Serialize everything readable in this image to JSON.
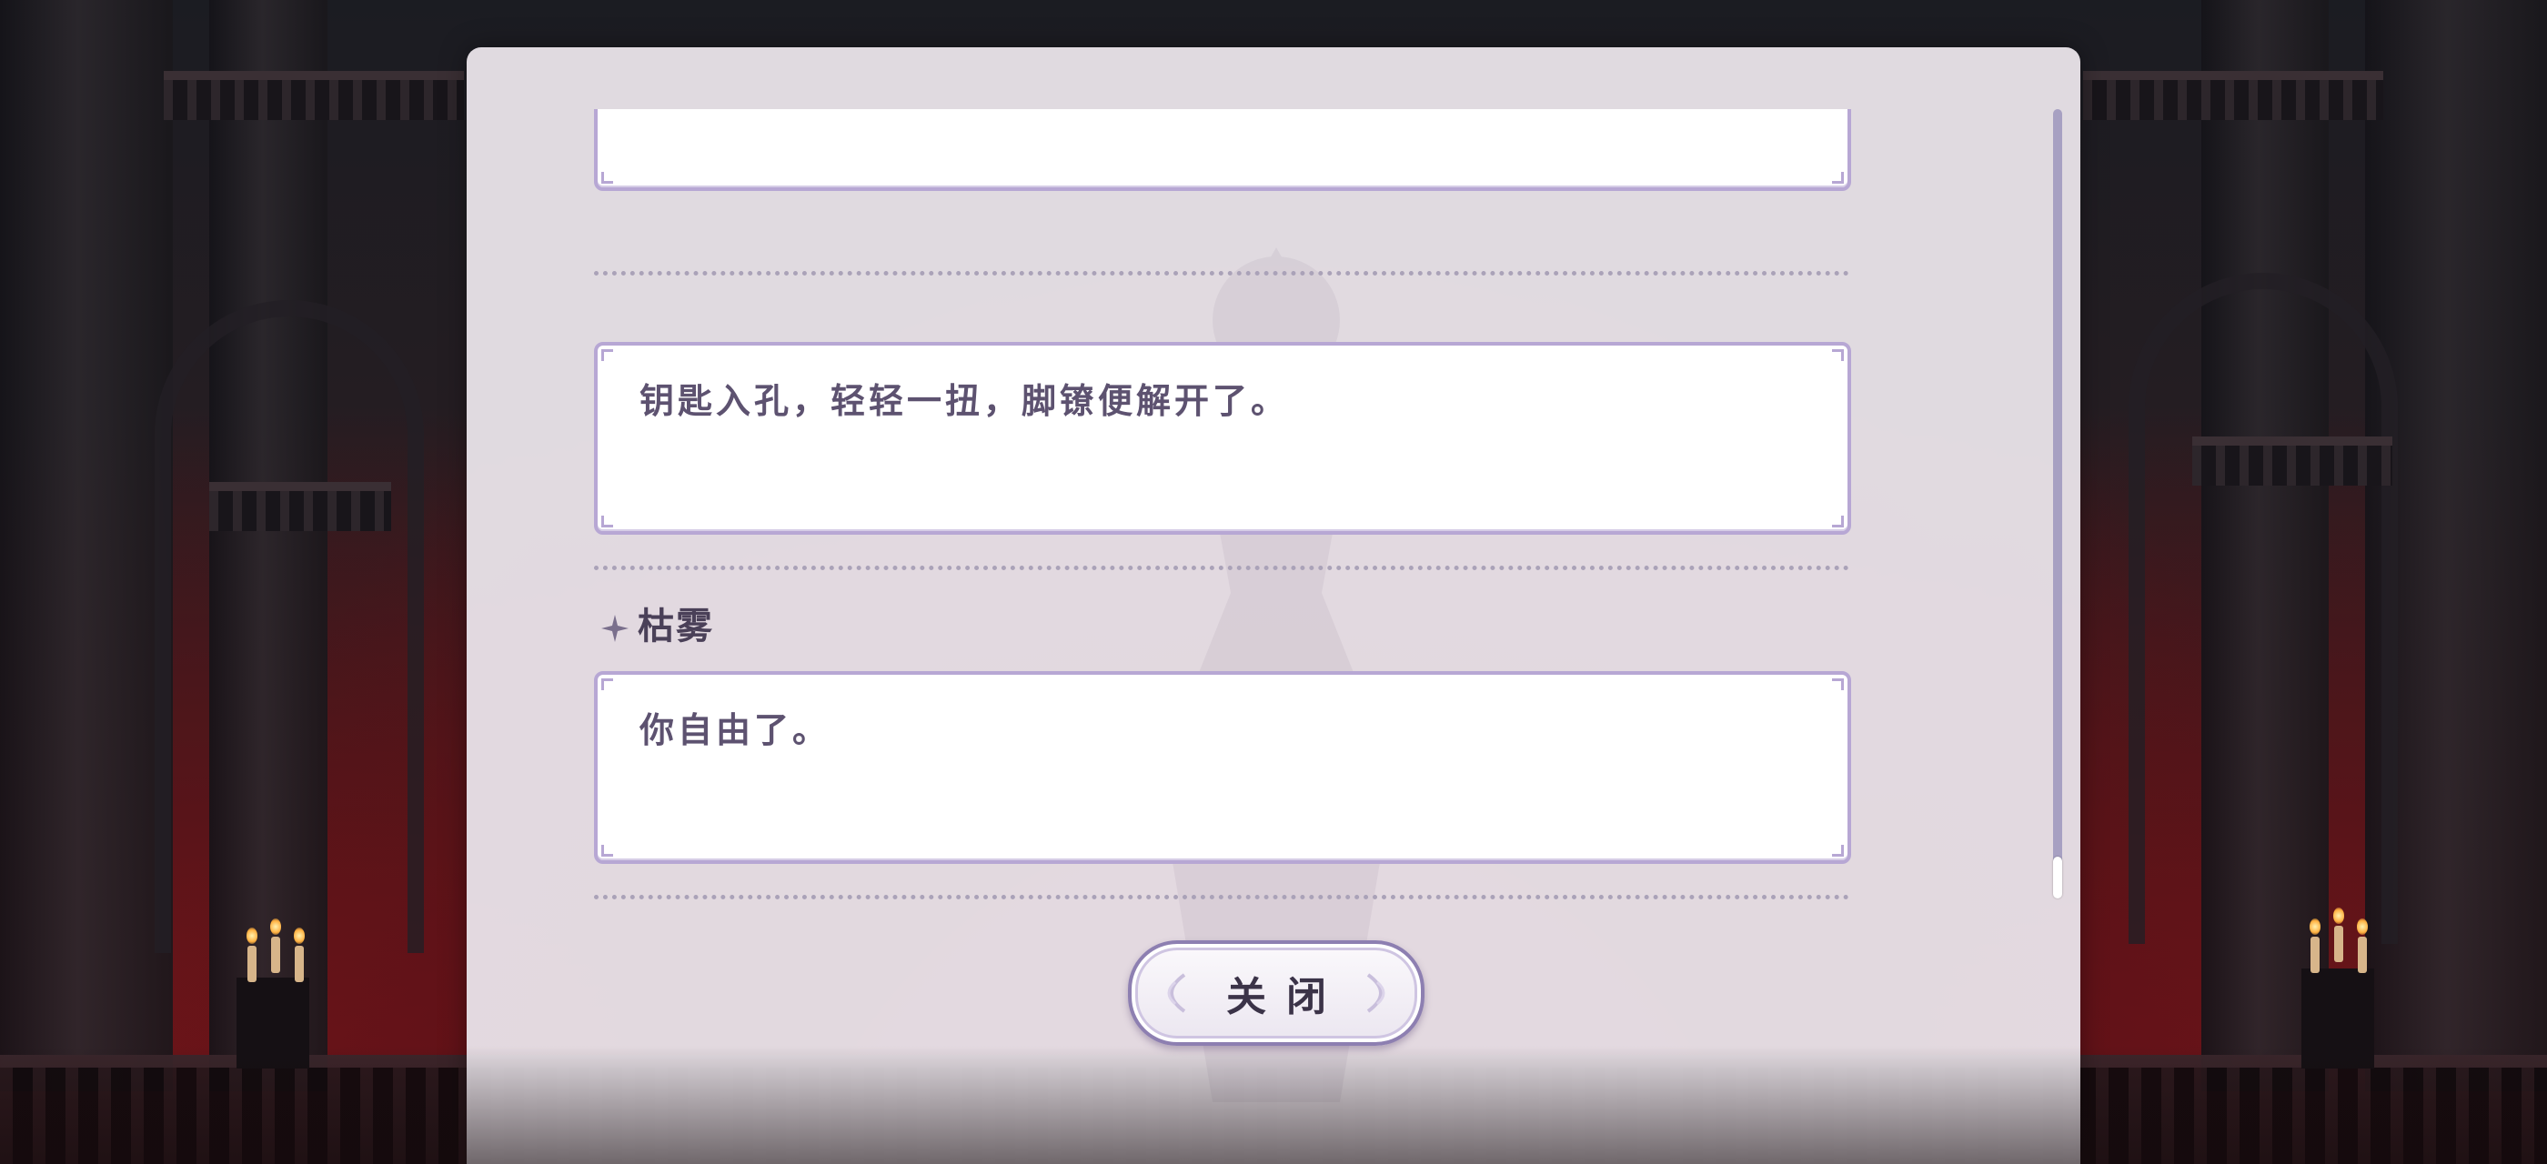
{
  "dialog_log": {
    "entries": [
      {
        "speaker": "",
        "text": ""
      },
      {
        "speaker": "",
        "text": "钥匙入孔，轻轻一扭，脚镣便解开了。"
      },
      {
        "speaker": "枯雾",
        "text": "你自由了。"
      }
    ]
  },
  "close_button": {
    "label": "关闭"
  },
  "icons": {
    "speaker_marker": "four-point-star-icon",
    "close_decoration": "ornament-icon"
  },
  "colors": {
    "panel_bg": "#e8e2e8",
    "box_border": "#b7a7d4",
    "text": "#5d5270",
    "scroll_track": "#a7a0c2"
  }
}
